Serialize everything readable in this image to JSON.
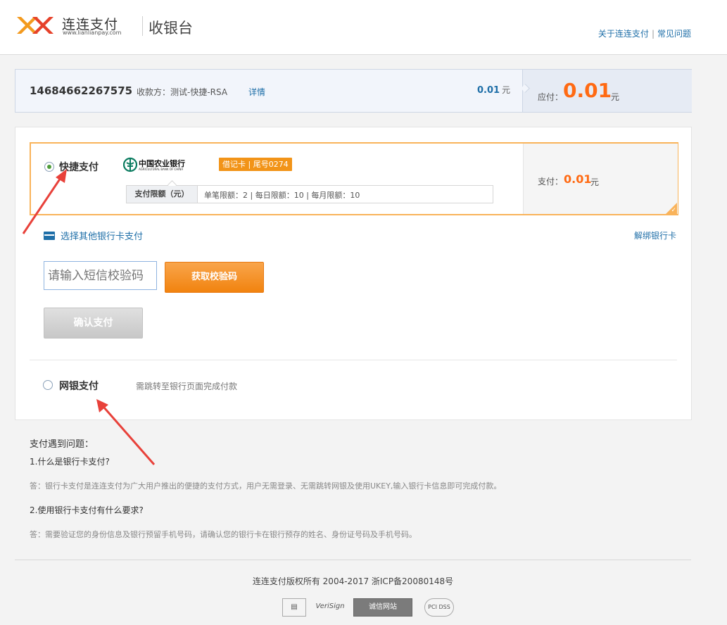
{
  "header": {
    "brand_name": "连连支付",
    "brand_url": "www.lianlianpay.com",
    "page_title": "收银台",
    "links": [
      "关于连连支付",
      "常见问题"
    ],
    "link_separator": "|"
  },
  "order": {
    "number": "14684662267575",
    "payee": "收款方：测试-快捷-RSA",
    "detail_label": "详情",
    "amount": "0.01",
    "amount_unit": "元",
    "due_label": "应付：",
    "due_amount": "0.01",
    "due_unit": "元"
  },
  "quick_pay": {
    "label": "快捷支付",
    "selected": true,
    "bank_name": "中国农业银行",
    "bank_name_en": "AGRICULTURAL BANK OF CHINA",
    "card_badge": "借记卡 | 尾号0274",
    "limit_label": "支付限额（元）",
    "limit_text": "单笔限额：2  |  每日限额：10  |  每月限额：10",
    "pay_label": "支付：",
    "pay_amount": "0.01",
    "pay_unit": "元"
  },
  "actions": {
    "other_card": "选择其他银行卡支付",
    "unbind": "解绑银行卡",
    "sms_placeholder": "请输入短信校验码",
    "get_code": "获取校验码",
    "confirm": "确认支付"
  },
  "net_bank": {
    "label": "网银支付",
    "selected": false,
    "note": "需跳转至银行页面完成付款"
  },
  "faq": {
    "title": "支付遇到问题：",
    "items": [
      {
        "q": "1.什么是银行卡支付?",
        "a": "答：银行卡支付是连连支付为广大用户推出的便捷的支付方式，用户无需登录、无需跳转网银及使用UKEY,输入银行卡信息即可完成付款。"
      },
      {
        "q": "2.使用银行卡支付有什么要求?",
        "a": "答：需要验证您的身份信息及银行预留手机号码，请确认您的银行卡在银行预存的姓名、身份证号码及手机号码。"
      }
    ]
  },
  "footer": {
    "copyright": "连连支付版权所有 2004-2017    浙ICP备20080148号",
    "badges": [
      "VeriSign",
      "诚信网站",
      "PCI DSS"
    ]
  },
  "colors": {
    "accent_orange": "#ff6a13",
    "link_blue": "#1f6fa8",
    "selected_border": "#f9b35a",
    "annotation_arrow": "#e8413a"
  }
}
